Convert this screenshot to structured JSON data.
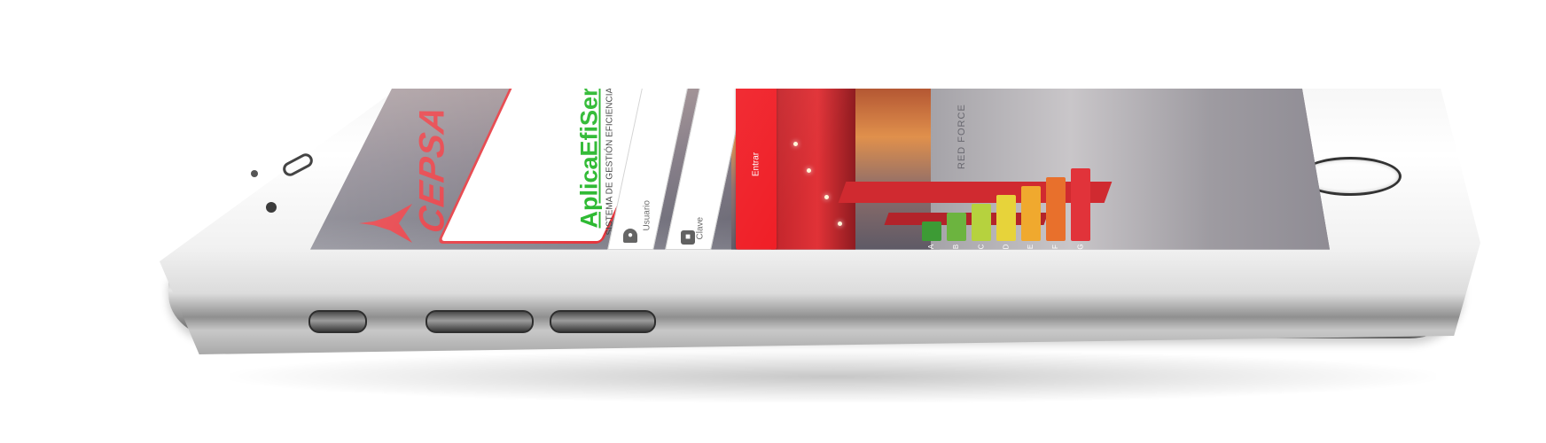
{
  "app": {
    "logo_text": "CEPSA",
    "title": "AplicaEfiServicio",
    "subtitle": "SISTEMA DE GESTIÓN EFICIENCIA ENERGÉTICA"
  },
  "login": {
    "username_placeholder": "Usuario",
    "password_placeholder": "Clave",
    "submit_label": "Entrar"
  },
  "background": {
    "sign_text": "RED FORCE"
  },
  "energy_rating": {
    "grades": [
      "A",
      "B",
      "C",
      "D",
      "E",
      "F",
      "G"
    ],
    "colors": [
      "#3d9b35",
      "#6cb43f",
      "#b6d23e",
      "#e7d33a",
      "#f0a92e",
      "#e8702c",
      "#e1333a"
    ]
  },
  "icons": {
    "user_icon": "user-icon",
    "lock_icon": "lock-icon",
    "logo_mark": "cepsa-star-icon"
  },
  "colors": {
    "brand_red": "#e3232b",
    "title_green": "#17b21c",
    "button_red": "#f01f27"
  }
}
